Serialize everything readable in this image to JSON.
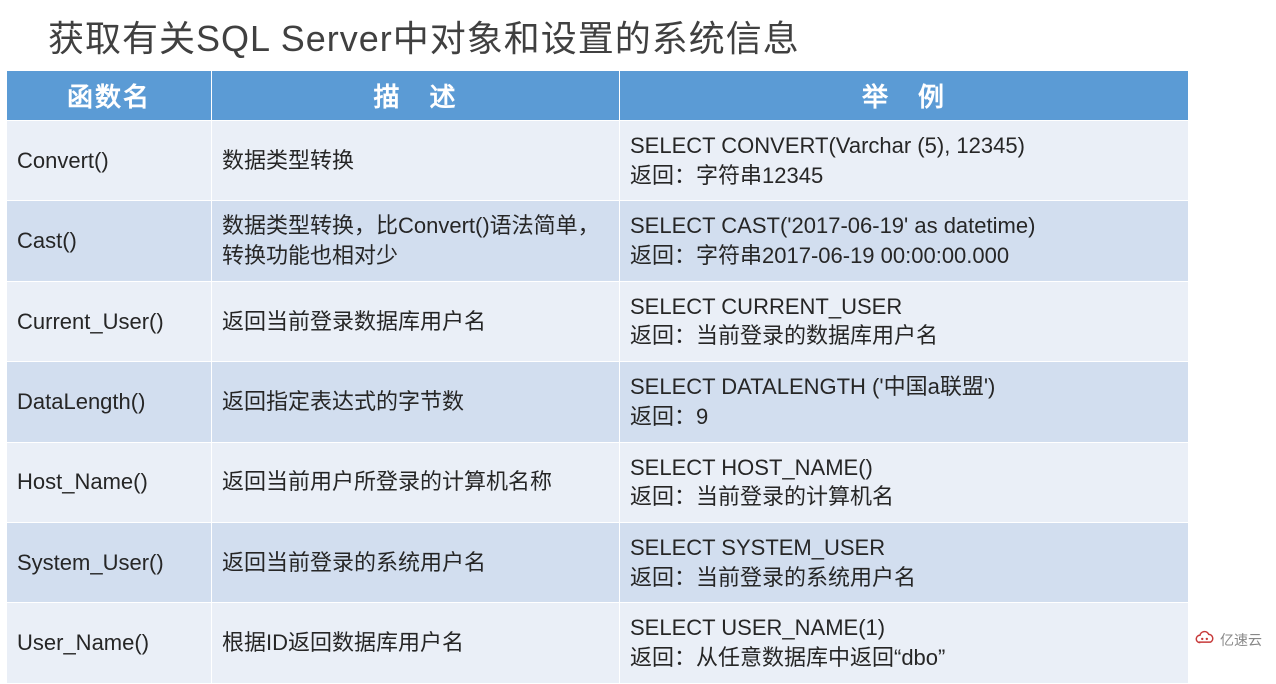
{
  "title": "获取有关SQL Server中对象和设置的系统信息",
  "headers": {
    "c1": "函数名",
    "c2": "描　述",
    "c3": "举　例"
  },
  "rows": [
    {
      "fn": "Convert()",
      "desc": "数据类型转换",
      "ex": "SELECT CONVERT(Varchar (5), 12345)\n返回：字符串12345"
    },
    {
      "fn": "Cast()",
      "desc": "数据类型转换，比Convert()语法简单，转换功能也相对少",
      "ex": "SELECT CAST('2017-06-19'   as datetime)\n返回：字符串2017-06-19 00:00:00.000"
    },
    {
      "fn": "Current_User()",
      "desc": "返回当前登录数据库用户名",
      "ex": "SELECT CURRENT_USER\n返回：当前登录的数据库用户名"
    },
    {
      "fn": "DataLength()",
      "desc": "返回指定表达式的字节数",
      "ex": "SELECT DATALENGTH ('中国a联盟')\n返回：9"
    },
    {
      "fn": "Host_Name()",
      "desc": "返回当前用户所登录的计算机名称",
      "ex": "SELECT HOST_NAME()\n返回：当前登录的计算机名"
    },
    {
      "fn": "System_User()",
      "desc": "返回当前登录的系统用户名",
      "ex": "SELECT SYSTEM_USER\n返回：当前登录的系统用户名"
    },
    {
      "fn": "User_Name()",
      "desc": "根据ID返回数据库用户名",
      "ex": "SELECT USER_NAME(1)\n返回：从任意数据库中返回“dbo”"
    }
  ],
  "logo_text": "亿速云"
}
